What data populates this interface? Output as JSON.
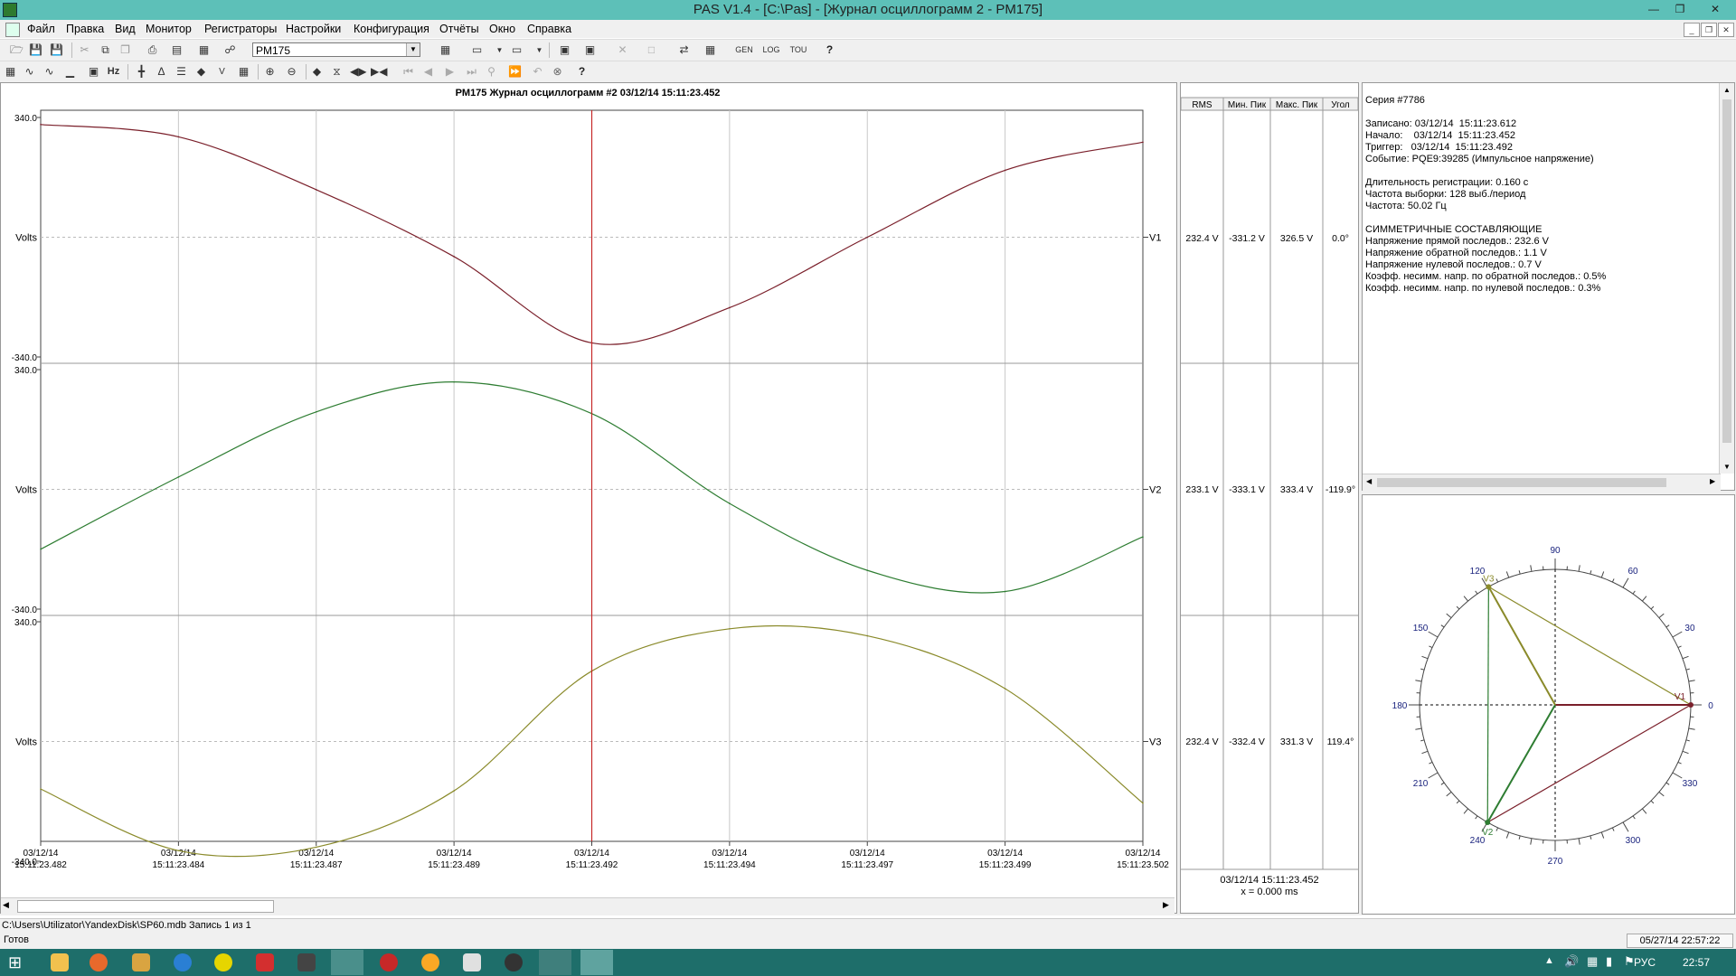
{
  "window": {
    "title": "PAS V1.4 - [C:\\Pas] - [Журнал осциллограмм 2 - PM175]"
  },
  "menu": [
    "Файл",
    "Правка",
    "Вид",
    "Монитор",
    "Регистраторы",
    "Настройки",
    "Конфигурация",
    "Отчёты",
    "Окно",
    "Справка"
  ],
  "toolbar": {
    "device_combo": "PM175",
    "btn_gen": "GEN",
    "btn_log": "LOG",
    "btn_tou": "TOU",
    "btn_hz": "Hz"
  },
  "chart": {
    "header": "PM175  Журнал осциллограмм #2   03/12/14  15:11:23.452",
    "ylabel": "Volts",
    "ymax_label": "340.0",
    "ymin_label": "-340.0",
    "time_labels": [
      {
        "date": "03/12/14",
        "time": "15:11:23.482"
      },
      {
        "date": "03/12/14",
        "time": "15:11:23.484"
      },
      {
        "date": "03/12/14",
        "time": "15:11:23.487"
      },
      {
        "date": "03/12/14",
        "time": "15:11:23.489"
      },
      {
        "date": "03/12/14",
        "time": "15:11:23.492"
      },
      {
        "date": "03/12/14",
        "time": "15:11:23.494"
      },
      {
        "date": "03/12/14",
        "time": "15:11:23.497"
      },
      {
        "date": "03/12/14",
        "time": "15:11:23.499"
      },
      {
        "date": "03/12/14",
        "time": "15:11:23.502"
      }
    ],
    "channels": [
      {
        "name": "V1",
        "color": "#7a1f2a"
      },
      {
        "name": "V2",
        "color": "#2e7d32"
      },
      {
        "name": "V3",
        "color": "#8a8a2a"
      }
    ],
    "cursor_color": "#c62828"
  },
  "chart_data": {
    "type": "line",
    "title": "PM175  Журнал осциллограмм #2   03/12/14  15:11:23.452",
    "ylabel": "Volts",
    "ylim": [
      -340,
      340
    ],
    "x": [
      "15:11:23.482",
      "15:11:23.484",
      "15:11:23.487",
      "15:11:23.489",
      "15:11:23.492",
      "15:11:23.494",
      "15:11:23.497",
      "15:11:23.499",
      "15:11:23.502"
    ],
    "series": [
      {
        "name": "V1",
        "values": [
          320,
          285,
          135,
          -55,
          -300,
          -200,
          0,
          190,
          270
        ]
      },
      {
        "name": "V2",
        "values": [
          -170,
          35,
          220,
          305,
          215,
          -40,
          -230,
          -290,
          -135
        ]
      },
      {
        "name": "V3",
        "values": [
          -135,
          -310,
          -300,
          -140,
          200,
          320,
          300,
          150,
          -175
        ]
      }
    ]
  },
  "table": {
    "headers": [
      "RMS",
      "Мин. Пик",
      "Макс. Пик",
      "Угол"
    ],
    "rows": [
      [
        "232.4 V",
        "-331.2 V",
        "326.5 V",
        "0.0°"
      ],
      [
        "233.1 V",
        "-333.1 V",
        "333.4 V",
        "-119.9°"
      ],
      [
        "232.4 V",
        "-332.4 V",
        "331.3 V",
        "119.4°"
      ]
    ],
    "cursor_time": "03/12/14  15:11:23.452",
    "cursor_x": "x = 0.000 ms"
  },
  "info": {
    "lines": [
      "Серия #7786",
      "",
      "Записано: 03/12/14  15:11:23.612",
      "Начало:    03/12/14  15:11:23.452",
      "Триггер:   03/12/14  15:11:23.492",
      "Событие: PQE9:39285 (Импульсное напряжение)",
      "",
      "Длительность регистрации: 0.160 с",
      "Частота выборки: 128 выб./период",
      "Частота: 50.02 Гц",
      "",
      "СИММЕТРИЧНЫЕ СОСТАВЛЯЮЩИЕ",
      "Напряжение прямой последов.: 232.6 V",
      "Напряжение обратной последов.: 1.1 V",
      "Напряжение нулевой последов.: 0.7 V",
      "Коэфф. несимм. напр. по обратной последов.: 0.5%",
      "Коэфф. несимм. напр. по нулевой последов.: 0.3%"
    ]
  },
  "phasor": {
    "angle_labels": [
      "0",
      "30",
      "60",
      "90",
      "120",
      "150",
      "180",
      "210",
      "240",
      "270",
      "300",
      "330"
    ],
    "vectors": [
      {
        "name": "V1",
        "angle": 0.0,
        "color": "#7a1f2a"
      },
      {
        "name": "V2",
        "angle": -119.9,
        "color": "#2e7d32"
      },
      {
        "name": "V3",
        "angle": 119.4,
        "color": "#8a8a2a"
      }
    ]
  },
  "status": {
    "path": "C:\\Users\\Utilizator\\YandexDisk\\SP60.mdb  Запись 1 из 1",
    "ready": "Готов",
    "datetime": "05/27/14 22:57:22"
  },
  "taskbar": {
    "lang": "РУС",
    "clock": "22:57"
  }
}
